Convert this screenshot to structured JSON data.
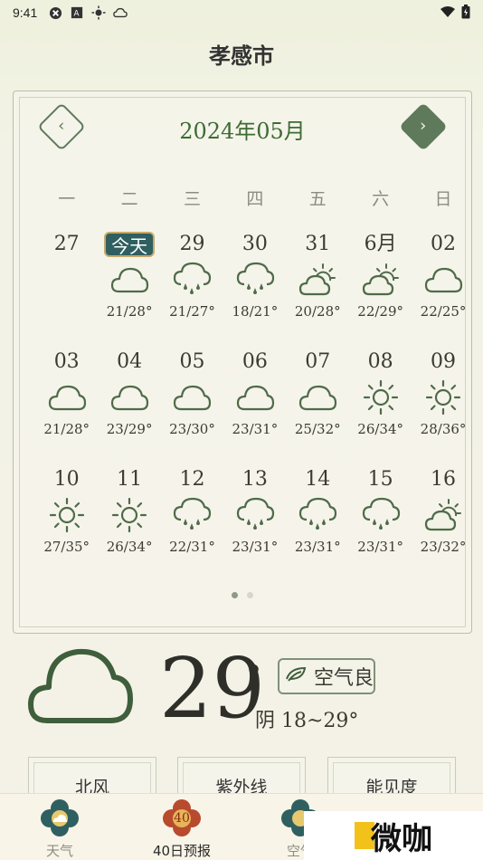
{
  "status": {
    "time": "9:41"
  },
  "city": "孝感市",
  "calendar": {
    "month_label": "2024年05月",
    "weekdays": [
      "一",
      "二",
      "三",
      "四",
      "五",
      "六",
      "日"
    ],
    "days": [
      {
        "label": "27",
        "icon": "",
        "temp": ""
      },
      {
        "label": "今天",
        "today": true,
        "icon": "cloud",
        "temp": "21/28°"
      },
      {
        "label": "29",
        "icon": "rain",
        "temp": "21/27°"
      },
      {
        "label": "30",
        "icon": "rain",
        "temp": "18/21°"
      },
      {
        "label": "31",
        "icon": "partly",
        "temp": "20/28°"
      },
      {
        "label": "6月",
        "icon": "partly",
        "temp": "22/29°"
      },
      {
        "label": "02",
        "icon": "cloud",
        "temp": "22/25°"
      },
      {
        "label": "03",
        "icon": "cloud",
        "temp": "21/28°"
      },
      {
        "label": "04",
        "icon": "cloud",
        "temp": "23/29°"
      },
      {
        "label": "05",
        "icon": "cloud",
        "temp": "23/30°"
      },
      {
        "label": "06",
        "icon": "cloud",
        "temp": "23/31°"
      },
      {
        "label": "07",
        "icon": "cloud",
        "temp": "25/32°"
      },
      {
        "label": "08",
        "icon": "sun",
        "temp": "26/34°"
      },
      {
        "label": "09",
        "icon": "sun",
        "temp": "28/36°"
      },
      {
        "label": "10",
        "icon": "sun",
        "temp": "27/35°"
      },
      {
        "label": "11",
        "icon": "sun",
        "temp": "26/34°"
      },
      {
        "label": "12",
        "icon": "rain",
        "temp": "22/31°"
      },
      {
        "label": "13",
        "icon": "rain",
        "temp": "23/31°"
      },
      {
        "label": "14",
        "icon": "rain",
        "temp": "23/31°"
      },
      {
        "label": "15",
        "icon": "rain",
        "temp": "23/31°"
      },
      {
        "label": "16",
        "icon": "partly",
        "temp": "23/32°"
      }
    ]
  },
  "current": {
    "temp": "29",
    "deg": "°",
    "aqi": "空气良",
    "range": "阴 18~29°",
    "icon": "cloud-icon"
  },
  "info_cards": [
    "北风",
    "紫外线",
    "能见度"
  ],
  "bottom_nav": [
    {
      "label": "天气",
      "icon": "weather-tab-icon"
    },
    {
      "label": "40日预报",
      "icon": "forecast-40-tab-icon",
      "badge": "40",
      "active": true
    },
    {
      "label": "空气",
      "icon": "air-tab-icon"
    }
  ],
  "watermark": "微咖",
  "colors": {
    "accent": "#3d6b35",
    "icon": "#4f6b4a",
    "today_bg": "#2f5f60"
  }
}
